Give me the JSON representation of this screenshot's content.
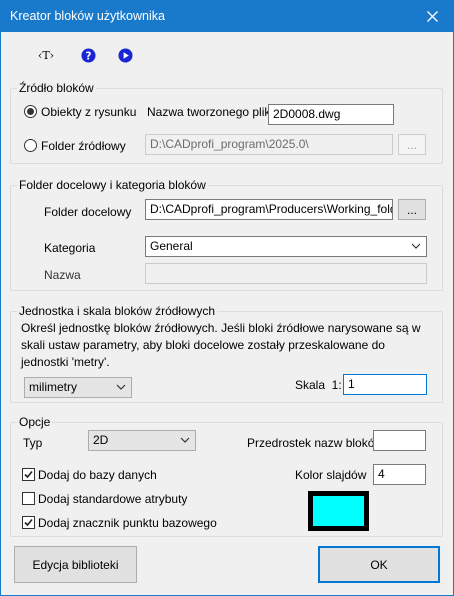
{
  "window": {
    "title": "Kreator bloków użytkownika",
    "close_glyph": "✕"
  },
  "toolbar": {
    "text_button_label": "‹T›",
    "help_icon": "question-circle-icon",
    "play_icon": "play-circle-icon",
    "icon_color": "#1a26d6"
  },
  "source": {
    "group_title": "Źródło bloków",
    "from_drawing_label": "Obiekty z rysunku",
    "from_drawing_selected": true,
    "filename_label": "Nazwa tworzonego pliku",
    "filename_value": "2D0008.dwg",
    "source_folder_label": "Folder źródłowy",
    "source_folder_selected": false,
    "source_folder_value": "D:\\CADprofi_program\\2025.0\\",
    "browse_label": "..."
  },
  "target": {
    "group_title": "Folder docelowy i kategoria bloków",
    "folder_label": "Folder docelowy",
    "folder_value": "D:\\CADprofi_program\\Producers\\Working_folder",
    "browse_label": "...",
    "category_label": "Kategoria",
    "category_value": "General",
    "name_label": "Nazwa",
    "name_value": ""
  },
  "units": {
    "group_title": "Jednostka i skala bloków źródłowych",
    "description": "Określ jednostkę bloków źródłowych. Jeśli bloki źródłowe narysowane są w skali ustaw parametry, aby bloki docelowe zostały przeskalowane do jednostki 'metry'.",
    "unit_value": "milimetry",
    "scale_label": "Skala  1:",
    "scale_value": "1"
  },
  "options": {
    "group_title": "Opcje",
    "type_label": "Typ",
    "type_value": "2D",
    "prefix_label": "Przedrostek nazw bloków",
    "prefix_value": "",
    "add_db_label": "Dodaj do bazy danych",
    "add_db_checked": true,
    "std_attrs_label": "Dodaj standardowe atrybuty",
    "std_attrs_checked": false,
    "base_point_label": "Dodaj znacznik punktu bazowego",
    "base_point_checked": true,
    "slide_color_label": "Kolor slajdów",
    "slide_color_value": "4",
    "slide_color_swatch": "#00ffff"
  },
  "footer": {
    "library_button": "Edycja biblioteki",
    "ok_button": "OK"
  }
}
